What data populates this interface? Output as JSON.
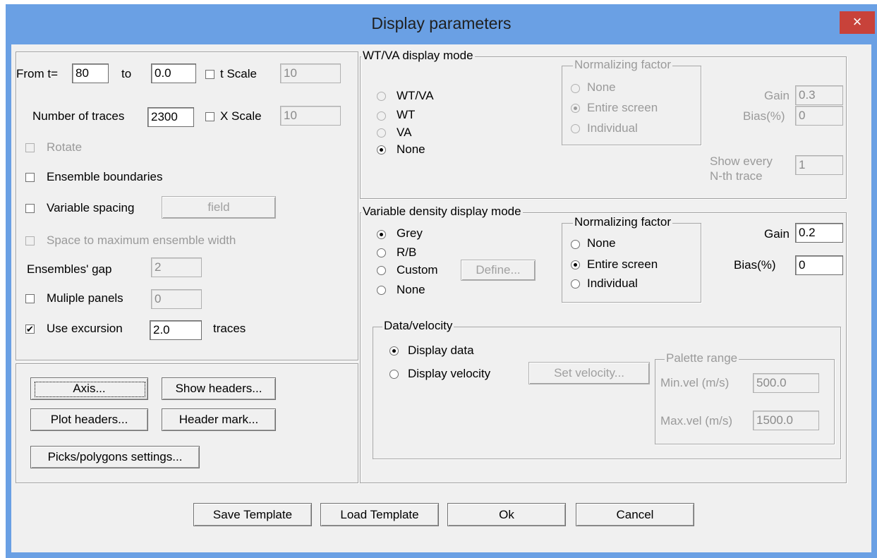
{
  "window": {
    "title": "Display parameters",
    "close_label": "×"
  },
  "left": {
    "from_label": "From t=",
    "from_value": "80",
    "to_label": "to",
    "to_value": "0.0",
    "tscale_label": "t Scale",
    "tscale_value": "10",
    "traces_label": "Number of traces",
    "traces_value": "2300",
    "xscale_label": "X Scale",
    "xscale_value": "10",
    "rotate_label": "Rotate",
    "ensemble_boundaries_label": "Ensemble boundaries",
    "variable_spacing_label": "Variable spacing",
    "field_button_label": "field",
    "space_max_label": "Space to maximum ensemble width",
    "ens_gap_label": "Ensembles' gap",
    "ens_gap_value": "2",
    "multiple_panels_label": "Muliple panels",
    "multiple_panels_value": "0",
    "use_excursion_label": "Use excursion",
    "use_excursion_checked": "✔",
    "excursion_value": "2.0",
    "traces_unit_label": "traces"
  },
  "buttons_panel": {
    "axis": "Axis...",
    "show_headers": "Show headers...",
    "plot_headers": "Plot headers...",
    "header_mark": "Header mark...",
    "picks_settings": "Picks/polygons settings..."
  },
  "wtva": {
    "legend": "WT/VA display mode",
    "options": [
      "WT/VA",
      "WT",
      "VA",
      "None"
    ],
    "norm_legend": "Normalizing factor",
    "norm_options": [
      "None",
      "Entire screen",
      "Individual"
    ],
    "gain_label": "Gain",
    "gain_value": "0.3",
    "bias_label": "Bias(%)",
    "bias_value": "0",
    "show_every_label_1": "Show every",
    "show_every_label_2": "N-th trace",
    "show_every_value": "1"
  },
  "vd": {
    "legend": "Variable density display mode",
    "options": [
      "Grey",
      "R/B",
      "Custom",
      "None"
    ],
    "define_label": "Define...",
    "norm_legend": "Normalizing factor",
    "norm_options": [
      "None",
      "Entire screen",
      "Individual"
    ],
    "gain_label": "Gain",
    "gain_value": "0.2",
    "bias_label": "Bias(%)",
    "bias_value": "0"
  },
  "data_velocity": {
    "legend": "Data/velocity",
    "display_data": "Display data",
    "display_velocity": "Display velocity",
    "set_velocity": "Set velocity...",
    "palette_legend": "Palette range",
    "min_label": "Min.vel (m/s)",
    "min_value": "500.0",
    "max_label": "Max.vel (m/s)",
    "max_value": "1500.0"
  },
  "footer": {
    "save_template": "Save Template",
    "load_template": "Load Template",
    "ok": "Ok",
    "cancel": "Cancel"
  },
  "colors": {
    "title_bar": "#6aa0e4",
    "close_button": "#c8423a",
    "dialog_bg": "#f0f0f0"
  }
}
